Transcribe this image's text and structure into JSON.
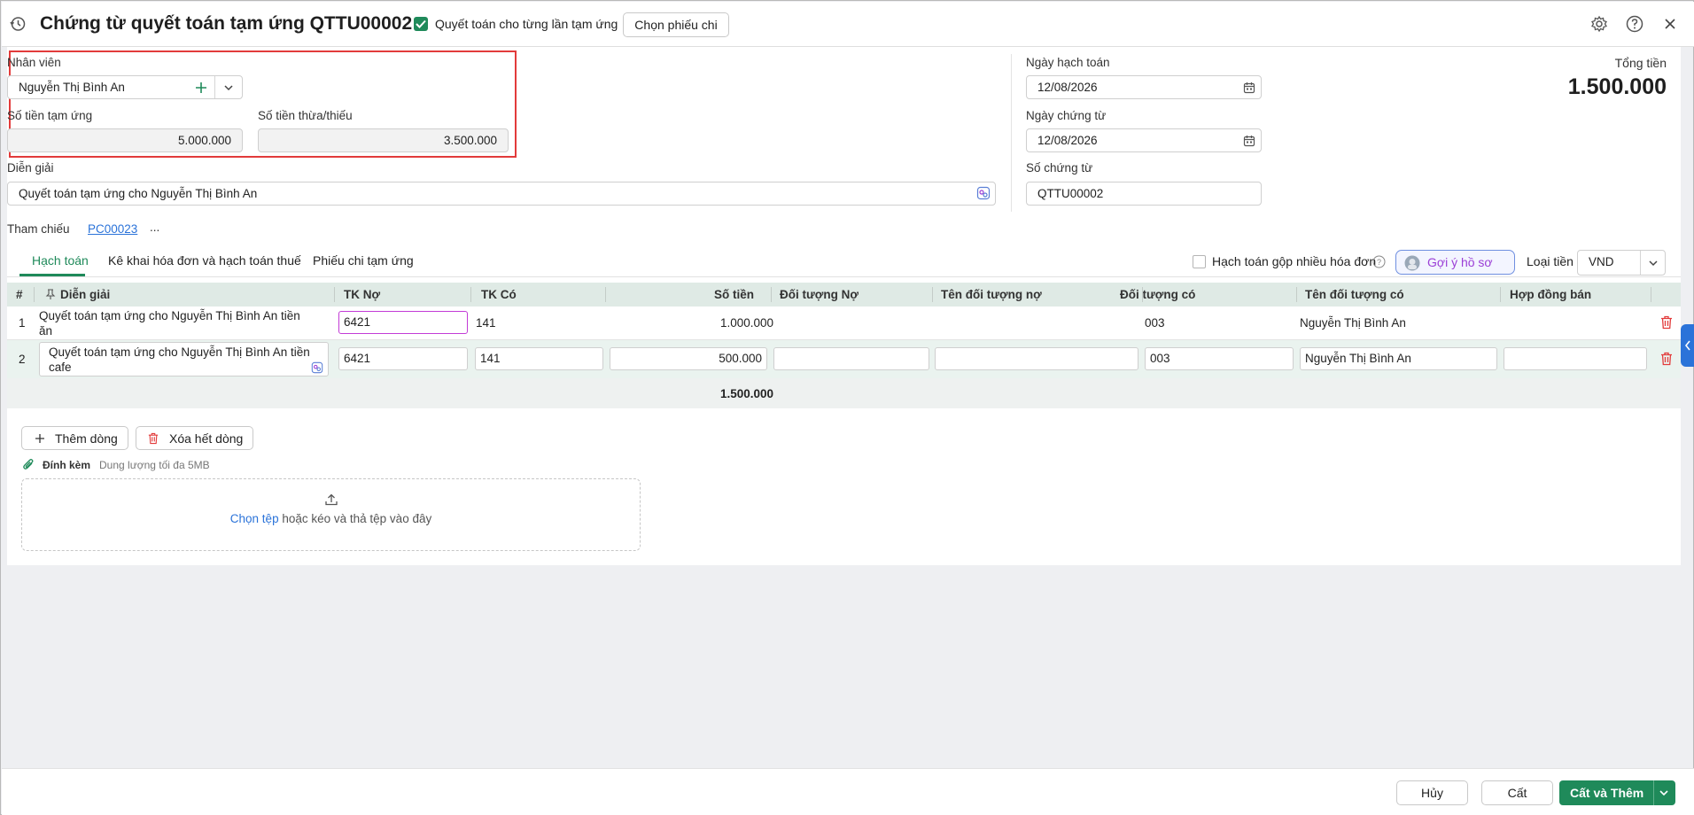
{
  "header": {
    "title": "Chứng từ quyết toán tạm ứng QTTU00002",
    "per_advance_label": "Quyết toán cho từng lần tạm ứng",
    "per_advance_checked": true,
    "choose_slip_button": "Chọn phiếu chi"
  },
  "form": {
    "employee_label": "Nhân viên",
    "employee_value": "Nguyễn Thị Bình An",
    "advance_amount_label": "Số tiền tạm ứng",
    "advance_amount_value": "5.000.000",
    "diff_amount_label": "Số tiền thừa/thiếu",
    "diff_amount_value": "3.500.000",
    "description_label": "Diễn giải",
    "description_value": "Quyết toán tạm ứng cho Nguyễn Thị Bình An",
    "posting_date_label": "Ngày hạch toán",
    "posting_date_value": "12/08/2026",
    "doc_date_label": "Ngày chứng từ",
    "doc_date_value": "12/08/2026",
    "doc_no_label": "Số chứng từ",
    "doc_no_value": "QTTU00002",
    "total_label": "Tổng tiền",
    "total_value": "1.500.000",
    "reference_label": "Tham chiếu",
    "reference_link": "PC00023",
    "reference_more": "..."
  },
  "tabs": [
    {
      "label": "Hạch toán",
      "active": true
    },
    {
      "label": "Kê khai hóa đơn và hạch toán thuế",
      "active": false
    },
    {
      "label": "Phiếu chi tạm ứng",
      "active": false
    }
  ],
  "toolbar": {
    "merge_invoices_label": "Hạch toán gộp nhiều hóa đơn",
    "suggest_button": "Gợi ý hồ sơ",
    "currency_label": "Loại tiền",
    "currency_value": "VND"
  },
  "grid": {
    "columns": [
      "#",
      "Diễn giải",
      "TK Nợ",
      "TK Có",
      "Số tiền",
      "Đối tượng Nợ",
      "Tên đối tượng nợ",
      "Đối tượng có",
      "Tên đối tượng có",
      "Hợp đồng bán"
    ],
    "rows": [
      {
        "no": "1",
        "description_line1": "Quyết toán tạm ứng cho Nguyễn Thị Bình An tiền",
        "description_line2": "ăn",
        "debit": "6421",
        "credit": "141",
        "amount": "1.000.000",
        "debit_obj": "",
        "debit_obj_name": "",
        "credit_obj": "003",
        "credit_obj_name": "Nguyễn Thị Bình An",
        "contract": ""
      },
      {
        "no": "2",
        "description_line1": "Quyết toán tạm ứng cho Nguyễn Thị Bình An tiền",
        "description_line2": "cafe",
        "debit": "6421",
        "credit": "141",
        "amount": "500.000",
        "debit_obj": "",
        "debit_obj_name": "",
        "credit_obj": "003",
        "credit_obj_name": "Nguyễn Thị Bình An",
        "contract": ""
      }
    ],
    "total_amount": "1.500.000"
  },
  "actions": {
    "add_row": "Thêm dòng",
    "delete_all_rows": "Xóa hết dòng"
  },
  "attachment": {
    "label": "Đính kèm",
    "hint": "Dung lượng tối đa 5MB",
    "choose_file": "Chọn tệp",
    "drop_text": "hoặc kéo và thả tệp vào đây"
  },
  "footer": {
    "cancel": "Hủy",
    "save": "Cất",
    "save_and_add": "Cất và Thêm"
  },
  "colors": {
    "accent_green": "#1f8a5a",
    "link_blue": "#2b73d9",
    "danger_red": "#e23b3b",
    "suggest_purple": "#9b3fd6"
  }
}
